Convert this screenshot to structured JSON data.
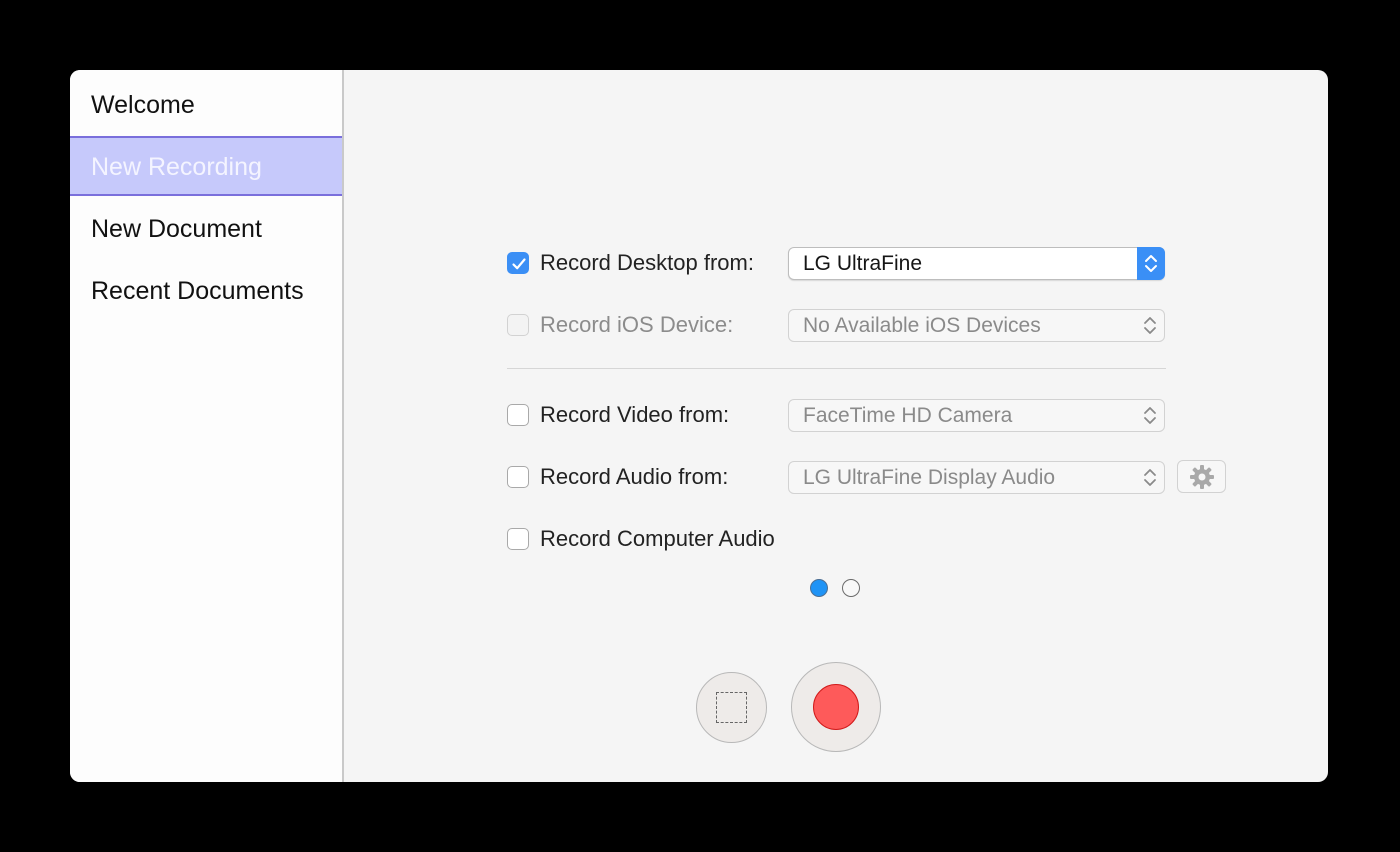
{
  "sidebar": {
    "items": [
      {
        "label": "Welcome",
        "selected": false
      },
      {
        "label": "New Recording",
        "selected": true
      },
      {
        "label": "New Document",
        "selected": false
      },
      {
        "label": "Recent Documents",
        "selected": false
      }
    ]
  },
  "options": {
    "desktop": {
      "label": "Record Desktop from:",
      "checked": true,
      "enabled": true,
      "value": "LG UltraFine"
    },
    "ios": {
      "label": "Record iOS Device:",
      "checked": false,
      "enabled": false,
      "value": "No Available iOS Devices"
    },
    "video": {
      "label": "Record Video from:",
      "checked": false,
      "enabled": true,
      "value": "FaceTime HD Camera"
    },
    "audio": {
      "label": "Record Audio from:",
      "checked": false,
      "enabled": true,
      "value": "LG UltraFine Display Audio"
    },
    "computer_audio": {
      "label": "Record Computer Audio",
      "checked": false,
      "enabled": true
    }
  },
  "pagination": {
    "current_page": 1,
    "total_pages": 2
  },
  "icons": {
    "checkmark": "checkmark-icon",
    "select_arrows": "chevron-up-down-icon",
    "gear": "gear-icon",
    "area": "dashed-rectangle-icon",
    "record": "record-dot-icon"
  },
  "colors": {
    "accent": "#3b8ff5",
    "sidebar_selected": "#c6c9fb",
    "sidebar_selected_border": "#7a6fdc",
    "record": "#fe5a5a",
    "page_dot_active": "#1f93f5"
  }
}
